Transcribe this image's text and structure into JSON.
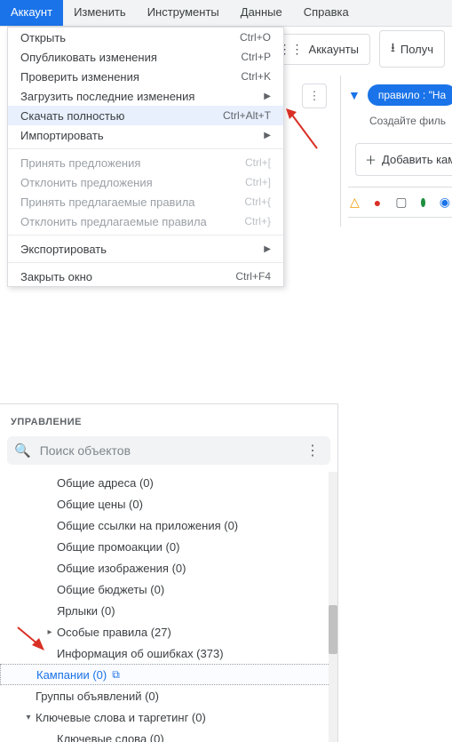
{
  "menubar": {
    "items": [
      {
        "label": "Аккаунт",
        "active": true
      },
      {
        "label": "Изменить"
      },
      {
        "label": "Инструменты"
      },
      {
        "label": "Данные"
      },
      {
        "label": "Справка"
      }
    ]
  },
  "dropdown": {
    "items": [
      {
        "label": "Открыть",
        "shortcut": "Ctrl+O"
      },
      {
        "label": "Опубликовать изменения",
        "shortcut": "Ctrl+P"
      },
      {
        "label": "Проверить изменения",
        "shortcut": "Ctrl+K"
      },
      {
        "label": "Загрузить последние изменения",
        "submenu": true
      },
      {
        "label": "Скачать полностью",
        "shortcut": "Ctrl+Alt+T",
        "highlighted": true
      },
      {
        "label": "Импортировать",
        "submenu": true
      },
      {
        "divider": true
      },
      {
        "label": "Принять предложения",
        "shortcut": "Ctrl+[",
        "disabled": true
      },
      {
        "label": "Отклонить предложения",
        "shortcut": "Ctrl+]",
        "disabled": true
      },
      {
        "label": "Принять предлагаемые правила",
        "shortcut": "Ctrl+{",
        "disabled": true
      },
      {
        "label": "Отклонить предлагаемые правила",
        "shortcut": "Ctrl+}",
        "disabled": true
      },
      {
        "divider": true
      },
      {
        "label": "Экспортировать",
        "submenu": true
      },
      {
        "divider": true
      },
      {
        "label": "Закрыть окно",
        "shortcut": "Ctrl+F4"
      }
    ]
  },
  "toolbar": {
    "accounts_label": "Аккаунты",
    "get_label": "Получ"
  },
  "right": {
    "chip_label": "правило : \"На",
    "hint": "Создайте филь",
    "add_label": "Добавить кам"
  },
  "manage": {
    "title": "УПРАВЛЕНИЕ",
    "search_placeholder": "Поиск объектов"
  },
  "tree": {
    "items": [
      {
        "label": "Общие адреса (0)",
        "indent": 3
      },
      {
        "label": "Общие цены (0)",
        "indent": 3
      },
      {
        "label": "Общие ссылки на приложения (0)",
        "indent": 3
      },
      {
        "label": "Общие промоакции (0)",
        "indent": 3
      },
      {
        "label": "Общие изображения (0)",
        "indent": 3
      },
      {
        "label": "Общие бюджеты (0)",
        "indent": 3
      },
      {
        "label": "Ярлыки (0)",
        "indent": 3
      },
      {
        "label": "Особые правила (27)",
        "indent": 2,
        "caret": true
      },
      {
        "label": "Информация об ошибках (373)",
        "indent": 2
      },
      {
        "label": "Кампании (0)",
        "indent": 1,
        "selected": true,
        "external": true
      },
      {
        "label": "Группы объявлений (0)",
        "indent": 1
      },
      {
        "label": "Ключевые слова и таргетинг (0)",
        "indent": 1,
        "caret": true,
        "expanded": true
      },
      {
        "label": "Ключевые слова (0)",
        "indent": 2
      }
    ]
  }
}
